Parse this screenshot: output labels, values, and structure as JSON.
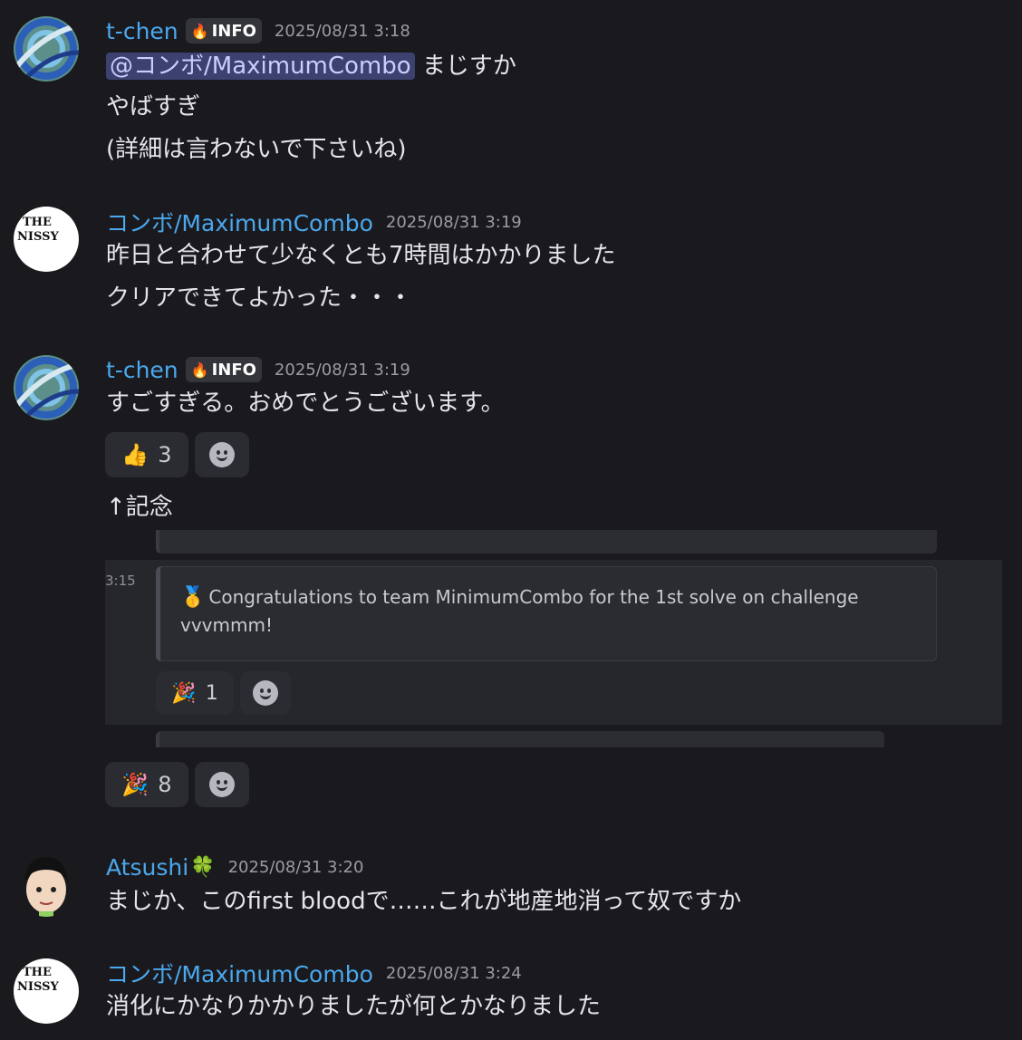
{
  "messages": [
    {
      "user": "t-chen",
      "tag": "INFO",
      "time": "2025/08/31 3:18",
      "mention": "@コンボ/MaximumCombo",
      "line1_rest": " まじすか",
      "line2": "やばすぎ",
      "line3": "(詳細は言わないで下さいね)"
    },
    {
      "user": "コンボ/MaximumCombo",
      "time": "2025/08/31 3:19",
      "avatar_text_1": "THE",
      "avatar_text_2": "NISSY",
      "line1": "昨日と合わせて少なくとも7時間はかかりました",
      "line2": "クリアできてよかった・・・"
    },
    {
      "user": "t-chen",
      "tag": "INFO",
      "time": "2025/08/31 3:19",
      "line1": "すごすぎる。おめでとうございます。",
      "reaction_emoji": "👍",
      "reaction_count": "3",
      "line2": "↑記念",
      "screenshot": {
        "time": "3:15",
        "embed_text": "Congratulations to team MinimumCombo for the 1st solve on challenge vvvmmm!",
        "reaction_emoji": "🎉",
        "reaction_count": "1"
      },
      "reaction2_emoji": "🎉",
      "reaction2_count": "8"
    },
    {
      "user": "Atsushi",
      "clover": "🍀",
      "time": "2025/08/31 3:20",
      "line1": "まじか、このfirst bloodで……これが地産地消って奴ですか"
    },
    {
      "user": "コンボ/MaximumCombo",
      "time": "2025/08/31 3:24",
      "avatar_text_1": "THE",
      "avatar_text_2": "NISSY",
      "line1": "消化にかなりかかりましたが何とかなりました"
    }
  ],
  "colors": {
    "background": "#1a1a1e",
    "username": "#4aa8ee",
    "mention_bg": "#3c4170",
    "reaction_bg": "#2b2c31"
  },
  "icons": [
    "flame-icon",
    "thumbs-up-emoji",
    "party-popper-emoji",
    "add-reaction-icon",
    "medal-icon",
    "clover-emoji"
  ]
}
